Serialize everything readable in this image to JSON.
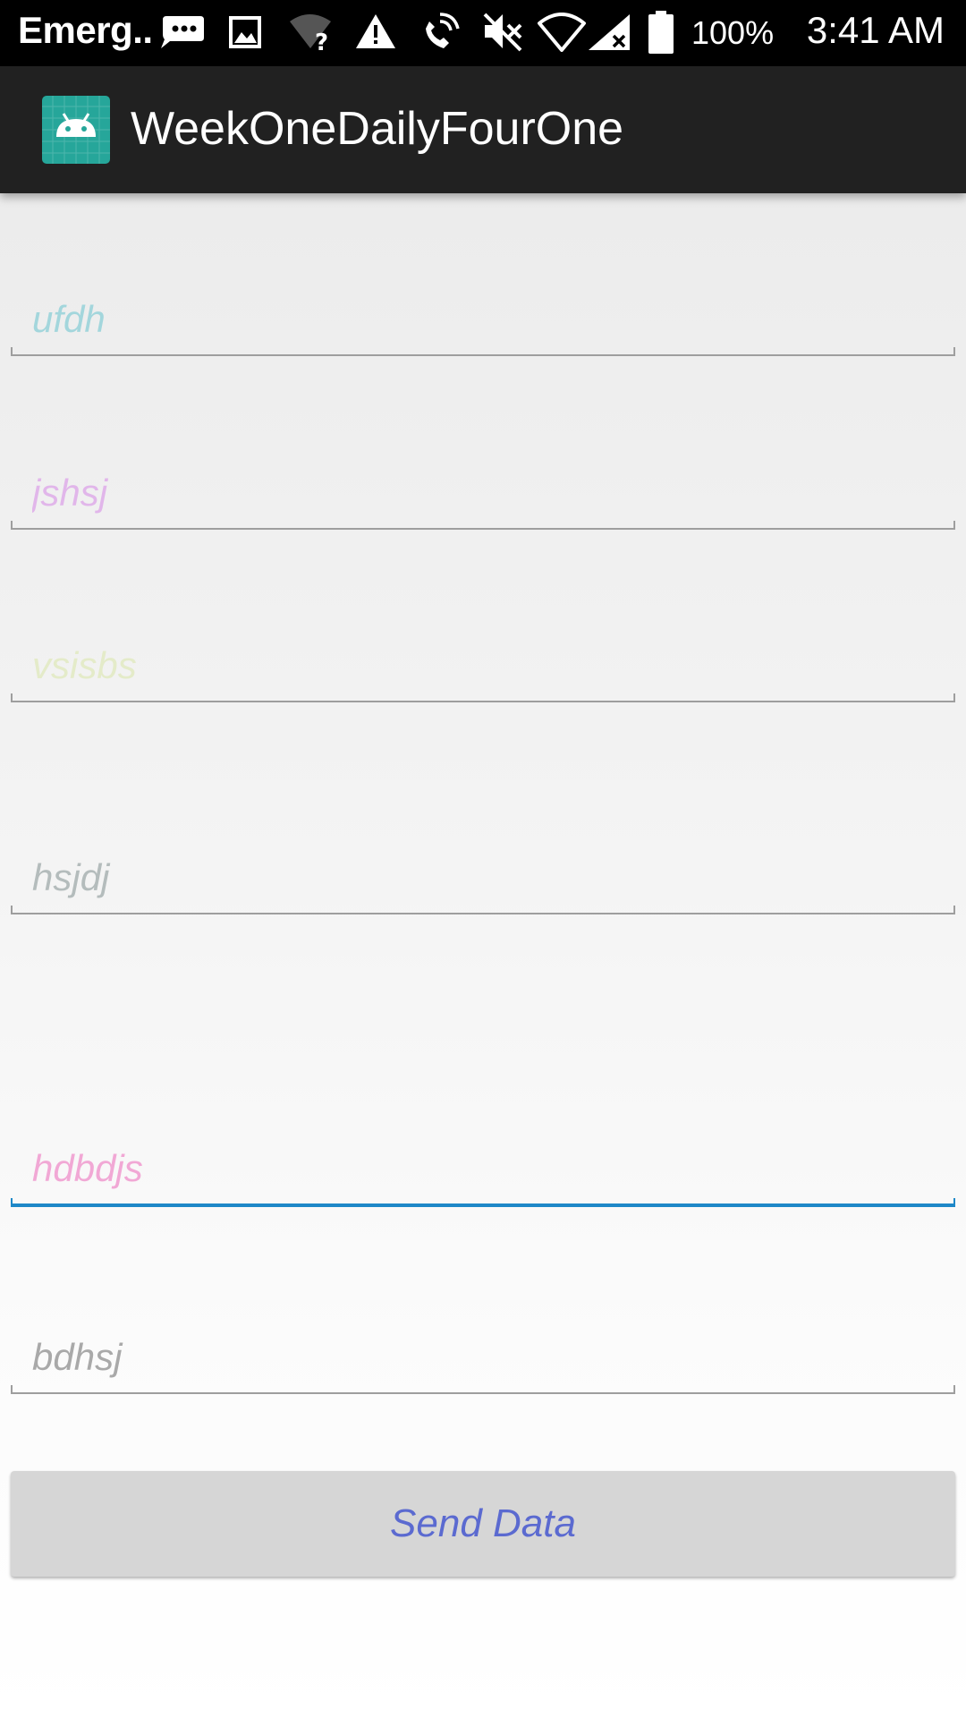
{
  "status_bar": {
    "carrier": "Emerg..",
    "battery_percent": "100%",
    "time": "3:41 AM",
    "icons": [
      "messages-icon",
      "image-icon",
      "wifi-unknown-icon",
      "warning-icon",
      "wifi-calling-icon",
      "mute-icon",
      "wifi-icon",
      "no-signal-icon",
      "battery-icon"
    ]
  },
  "app_bar": {
    "title": "WeekOneDailyFourOne",
    "icon": "android-icon",
    "icon_color": "#26a69a"
  },
  "form": {
    "fields": [
      {
        "placeholder": "ufdh",
        "hint_color": "#a3d6dc"
      },
      {
        "placeholder": "jshsj",
        "hint_color": "#e1b6ea"
      },
      {
        "placeholder": "vsisbs",
        "hint_color": "#e4ebc9"
      },
      {
        "placeholder": "hsjdj",
        "hint_color": "#b4bcbc"
      },
      {
        "placeholder": "hdbdjs",
        "hint_color": "#f1a8d5",
        "focused": true
      },
      {
        "placeholder": "bdhsj",
        "hint_color": "#a9a9a9"
      }
    ],
    "submit_label": "Send Data",
    "submit_text_color": "#5b6ad0",
    "focus_color": "#1e88c8"
  }
}
